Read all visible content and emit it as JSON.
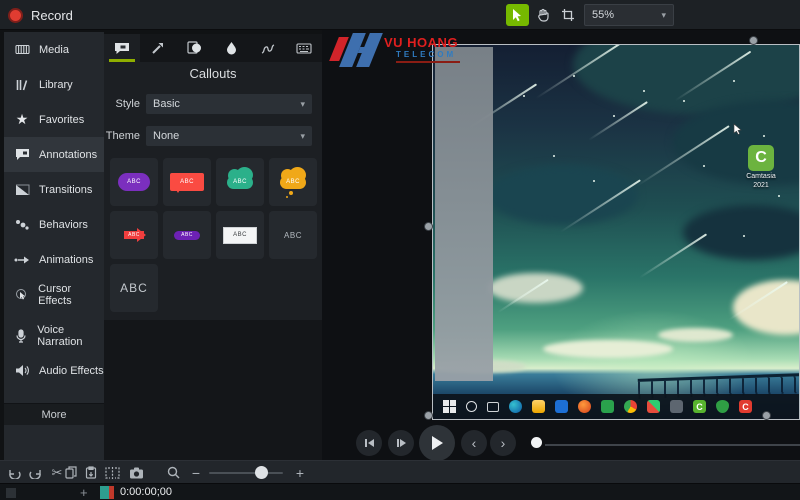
{
  "titlebar": {
    "record_label": "Record",
    "zoom_value": "55%",
    "tool_icons": [
      "cursor",
      "hand",
      "crop"
    ]
  },
  "sidebar": {
    "items": [
      {
        "label": "Media",
        "icon": "filmstrip"
      },
      {
        "label": "Library",
        "icon": "books"
      },
      {
        "label": "Favorites",
        "icon": "star"
      },
      {
        "label": "Annotations",
        "icon": "speech-bubble",
        "active": true
      },
      {
        "label": "Transitions",
        "icon": "transition"
      },
      {
        "label": "Behaviors",
        "icon": "falling-dots"
      },
      {
        "label": "Animations",
        "icon": "motion-arrow"
      },
      {
        "label": "Cursor Effects",
        "icon": "cursor-ring"
      },
      {
        "label": "Voice Narration",
        "icon": "microphone"
      },
      {
        "label": "Audio Effects",
        "icon": "speaker"
      }
    ],
    "more_label": "More"
  },
  "panel": {
    "tab_icons": [
      "callouts",
      "arrow",
      "shapes",
      "blur",
      "sketch-motion",
      "keystrokes"
    ],
    "title": "Callouts",
    "style_label": "Style",
    "style_value": "Basic",
    "theme_label": "Theme",
    "theme_value": "None",
    "tiles": [
      {
        "text": "ABC",
        "kind": "purple-rounded-callout"
      },
      {
        "text": "ABC",
        "kind": "red-speech-bubble"
      },
      {
        "text": "ABC",
        "kind": "teal-cloud-callout"
      },
      {
        "text": "ABC",
        "kind": "orange-thought-cloud"
      },
      {
        "text": "ABC",
        "kind": "red-arrow-callout"
      },
      {
        "text": "ABC",
        "kind": "purple-pill-callout"
      },
      {
        "text": "ABC",
        "kind": "white-text-box"
      },
      {
        "text": "ABC",
        "kind": "plain-text"
      },
      {
        "text": "ABC",
        "kind": "plain-text-large"
      }
    ]
  },
  "watermark": {
    "line1": "VU HOANG",
    "line2": "TELECOM"
  },
  "preview": {
    "desktop_icon_label": "Camtasia 2021",
    "taskbar_icons": [
      "start",
      "search",
      "task-view",
      "edge",
      "file-explorer",
      "app-blue",
      "app-orange",
      "app-green",
      "chrome",
      "office",
      "capture",
      "camtasia-green",
      "defender",
      "camtasia-red"
    ]
  },
  "playback": {
    "buttons": [
      "previous-frame",
      "step-forward",
      "play",
      "jump-back",
      "jump-forward"
    ]
  },
  "toolbar": {
    "icons": [
      "undo",
      "redo",
      "cut",
      "copy",
      "paste",
      "split",
      "screenshot",
      "zoom",
      "zoom-out",
      "zoom-in"
    ]
  },
  "timeline": {
    "add_label": "+",
    "timecode": "0:00:00;00"
  },
  "colors": {
    "highlight_red": "#dd2025",
    "record_red": "#e03c31",
    "accent_green": "#76b900",
    "tab_underline_green": "#8fae00",
    "callout_purple": "#7b2fbe",
    "callout_red": "#fa4b42",
    "callout_teal": "#2bb08a",
    "callout_orange": "#f0a818",
    "logo_red": "#e01f1f",
    "logo_blue": "#2f7bc0"
  }
}
